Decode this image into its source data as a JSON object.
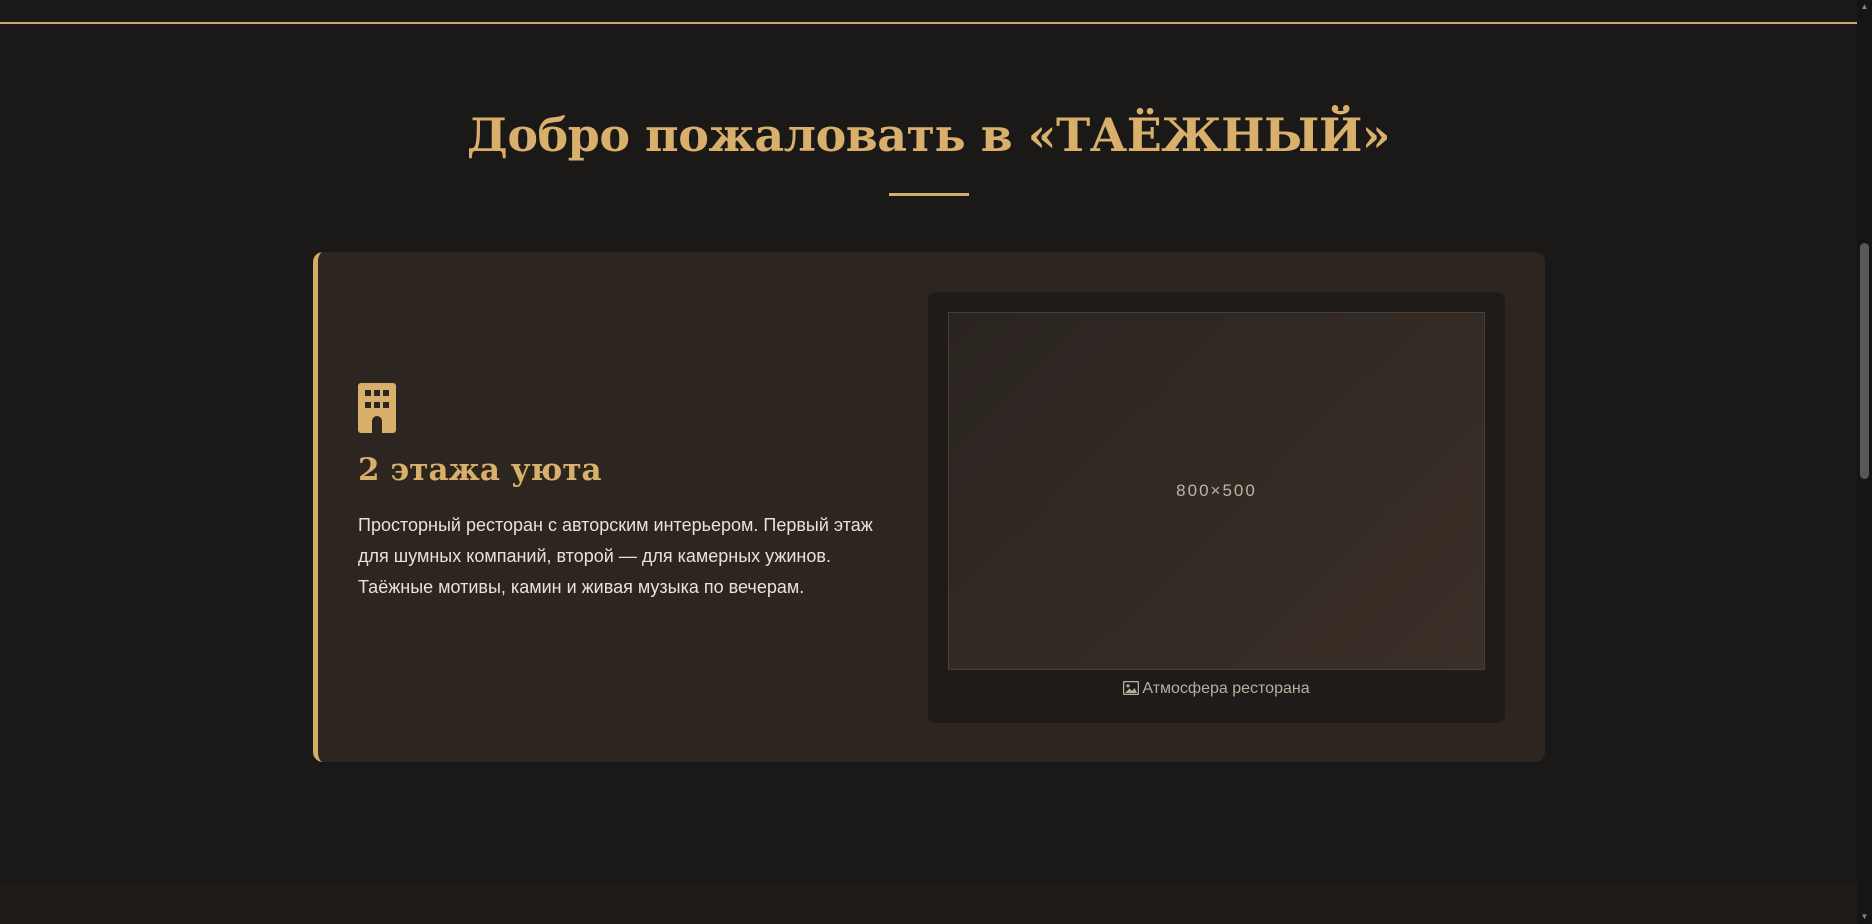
{
  "header": {
    "title": "Добро пожаловать в «ТАЁЖНЫЙ»"
  },
  "feature": {
    "icon": "building-icon",
    "title": "2 этажа уюта",
    "description": "Просторный ресторан с авторским интерьером. Первый этаж для шумных компаний, второй — для камерных ужинов. Таёжные мотивы, камин и живая музыка по вечерам.",
    "image_placeholder": "800×500",
    "caption_icon": "image-icon",
    "caption": "Атмосфера ресторана"
  },
  "colors": {
    "background": "#1b1917",
    "card": "#2c2520",
    "accent_gold": "#d8b06c",
    "text": "#e9e2da"
  }
}
